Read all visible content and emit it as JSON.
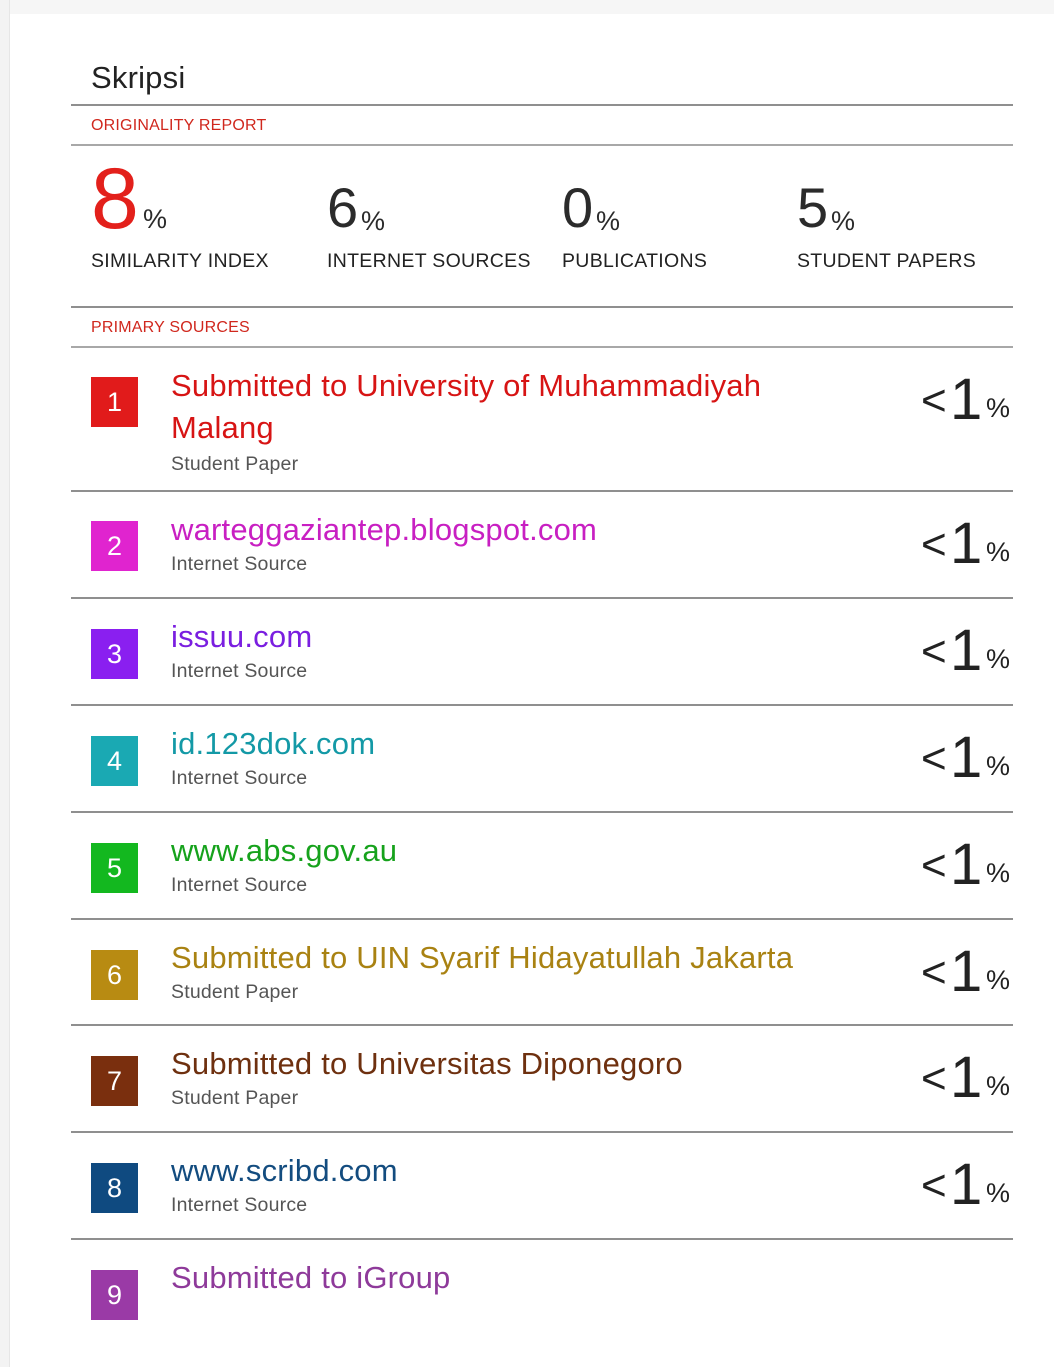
{
  "report": {
    "title": "Skripsi",
    "originality_label": "ORIGINALITY REPORT",
    "primary_sources_label": "PRIMARY SOURCES"
  },
  "stats": [
    {
      "value": "8",
      "unit": "%",
      "label": "SIMILARITY INDEX",
      "color": "#e3201b"
    },
    {
      "value": "6",
      "unit": "%",
      "label": "INTERNET SOURCES"
    },
    {
      "value": "0",
      "unit": "%",
      "label": "PUBLICATIONS"
    },
    {
      "value": "5",
      "unit": "%",
      "label": "STUDENT PAPERS"
    }
  ],
  "sources": [
    {
      "rank": "1",
      "title": "Submitted to University of Muhammadiyah Malang",
      "type": "Student Paper",
      "lt": "<",
      "pct": "1",
      "unit": "%",
      "color": "#e11b1b",
      "text_color": "#d71414"
    },
    {
      "rank": "2",
      "title": "warteggaziantep.blogspot.com",
      "type": "Internet Source",
      "lt": "<",
      "pct": "1",
      "unit": "%",
      "color": "#e024cf",
      "text_color": "#c81fc2"
    },
    {
      "rank": "3",
      "title": "issuu.com",
      "type": "Internet Source",
      "lt": "<",
      "pct": "1",
      "unit": "%",
      "color": "#8a1ff0",
      "text_color": "#7a1ee0"
    },
    {
      "rank": "4",
      "title": "id.123dok.com",
      "type": "Internet Source",
      "lt": "<",
      "pct": "1",
      "unit": "%",
      "color": "#1aa9b3",
      "text_color": "#1399a6"
    },
    {
      "rank": "5",
      "title": "www.abs.gov.au",
      "type": "Internet Source",
      "lt": "<",
      "pct": "1",
      "unit": "%",
      "color": "#13b81f",
      "text_color": "#16a21c"
    },
    {
      "rank": "6",
      "title": "Submitted to UIN Syarif Hidayatullah Jakarta",
      "type": "Student Paper",
      "lt": "<",
      "pct": "1",
      "unit": "%",
      "color": "#b88b12",
      "text_color": "#a98212"
    },
    {
      "rank": "7",
      "title": "Submitted to Universitas Diponegoro",
      "type": "Student Paper",
      "lt": "<",
      "pct": "1",
      "unit": "%",
      "color": "#7a2f0e",
      "text_color": "#6e300f"
    },
    {
      "rank": "8",
      "title": "www.scribd.com",
      "type": "Internet Source",
      "lt": "<",
      "pct": "1",
      "unit": "%",
      "color": "#0f4a80",
      "text_color": "#134c7f"
    },
    {
      "rank": "9",
      "title": "Submitted to iGroup",
      "type": "",
      "lt": "",
      "pct": "",
      "unit": "",
      "color": "#9a3aa6",
      "text_color": "#8e3a9a"
    }
  ]
}
